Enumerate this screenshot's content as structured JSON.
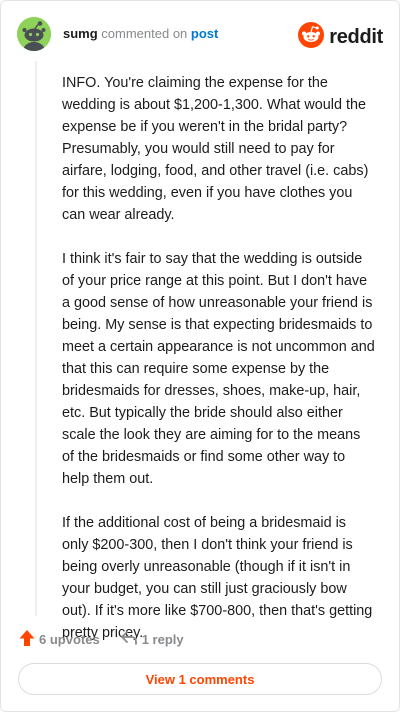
{
  "header": {
    "username": "sumg",
    "action_text": "commented on",
    "post_link_text": "post",
    "brand_name": "reddit",
    "avatar_icon": "snoo-avatar-icon",
    "brand_icon": "reddit-snoo-logo-icon"
  },
  "comment": {
    "paragraphs": [
      "INFO. You're claiming the expense for the wedding is about $1,200-1,300. What would the expense be if you weren't in the bridal party? Presumably, you would still need to pay for airfare, lodging, food, and other travel (i.e. cabs) for this wedding, even if you have clothes you can wear already.",
      "I think it's fair to say that the wedding is outside of your price range at this point. But I don't have a good sense of how unreasonable your friend is being. My sense is that expecting bridesmaids to meet a certain appearance is not uncommon and that this can require some expense by the bridesmaids for dresses, shoes, make-up, hair, etc. But typically the bride should also either scale the look they are aiming for to the means of the bridesmaids or find some other way to help them out.",
      "If the additional cost of being a bridesmaid is only $200-300, then I don't think your friend is being overly unreasonable (though if it isn't in your budget, you can still just graciously bow out). If it's more like $700-800, then that's getting pretty pricey."
    ]
  },
  "actions": {
    "upvotes_label": "6 upvotes",
    "reply_label": "1 reply",
    "upvote_icon": "upvote-arrow-icon",
    "reply_icon": "reply-arrow-icon"
  },
  "footer": {
    "view_comments_label": "View 1 comments"
  },
  "colors": {
    "accent": "#ff4500",
    "link": "#0079d3",
    "avatar_bg": "#8fd25a",
    "muted": "#878a8c",
    "text": "#1c1c1c"
  }
}
